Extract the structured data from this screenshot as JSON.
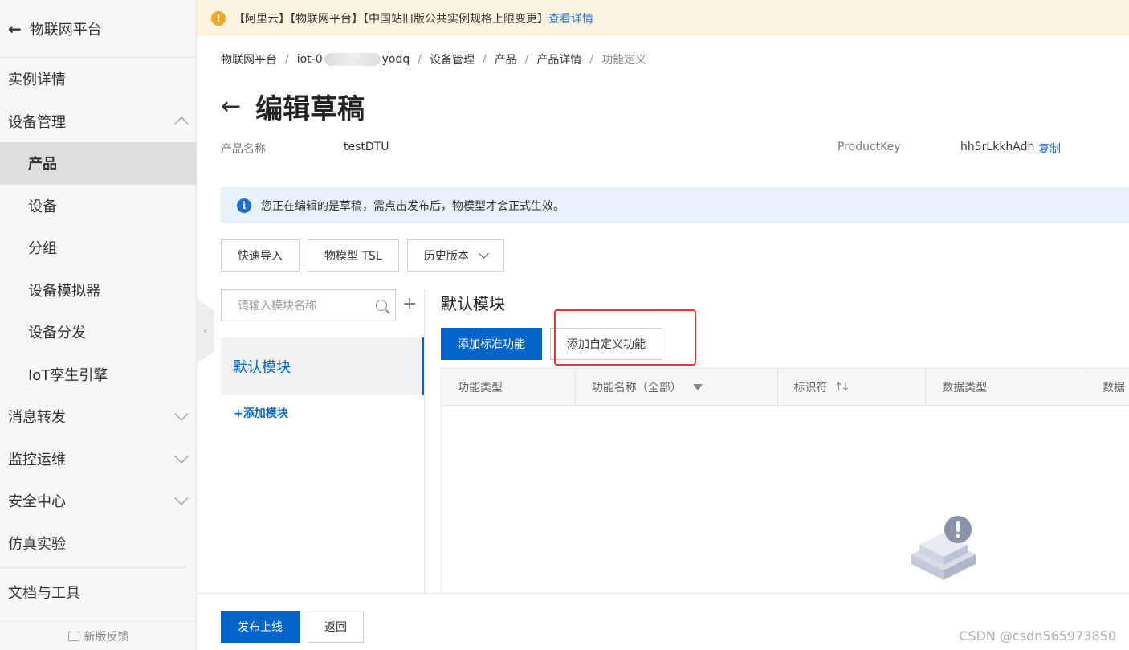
{
  "sidebar": {
    "title": "物联网平台",
    "items": [
      {
        "label": "实例详情"
      },
      {
        "label": "设备管理"
      },
      {
        "label": "产品"
      },
      {
        "label": "设备"
      },
      {
        "label": "分组"
      },
      {
        "label": "设备模拟器"
      },
      {
        "label": "设备分发"
      },
      {
        "label": "IoT孪生引擎"
      },
      {
        "label": "消息转发"
      },
      {
        "label": "监控运维"
      },
      {
        "label": "安全中心"
      },
      {
        "label": "仿真实验"
      },
      {
        "label": "文档与工具"
      }
    ],
    "feedback": "新版反馈"
  },
  "notice": {
    "text": "【阿里云】【物联网平台】【中国站旧版公共实例规格上限变更】",
    "link": "查看详情"
  },
  "breadcrumb": {
    "b1": "物联网平台",
    "b2_prefix": "iot-0",
    "b2_suffix": "yodq",
    "b3": "设备管理",
    "b4": "产品",
    "b5": "产品详情",
    "b6": "功能定义"
  },
  "page": {
    "title": "编辑草稿",
    "product_name_label": "产品名称",
    "product_name": "testDTU",
    "product_key_label": "ProductKey",
    "product_key": "hh5rLkkhAdh",
    "copy": "复制",
    "info": "您正在编辑的是草稿，需点击发布后，物模型才会正式生效。"
  },
  "toolbar": {
    "quick_import": "快速导入",
    "tsl": "物模型 TSL",
    "history": "历史版本"
  },
  "modules": {
    "search_placeholder": "请输入模块名称",
    "items": [
      {
        "label": "默认模块"
      }
    ],
    "add": "+添加模块"
  },
  "content": {
    "module_title": "默认模块",
    "add_standard": "添加标准功能",
    "add_custom": "添加自定义功能",
    "columns": [
      "功能类型",
      "功能名称（全部）",
      "标识符",
      "数据类型",
      "数据"
    ]
  },
  "footer": {
    "publish": "发布上线",
    "back": "返回",
    "watermark": "CSDN @csdn565973850"
  },
  "colors": {
    "primary": "#0064c8",
    "highlight_box": "#e53935",
    "notice_bg": "#fdf3e1",
    "info_bg": "#e8f2fd"
  }
}
